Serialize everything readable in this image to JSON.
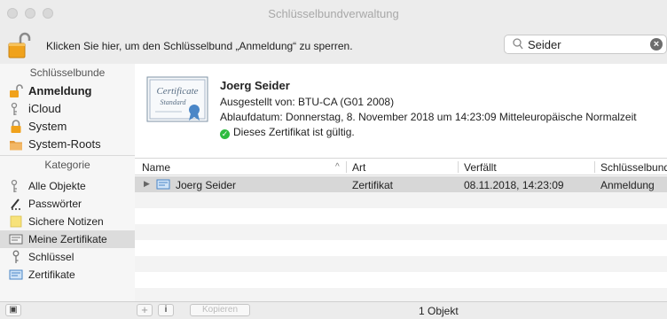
{
  "window": {
    "title": "Schlüsselbundverwaltung"
  },
  "toolbar": {
    "lock_text": "Klicken Sie hier, um den Schlüsselbund „Anmeldung“ zu sperren.",
    "search_value": "Seider"
  },
  "sidebar": {
    "keychains_header": "Schlüsselbunde",
    "keychains": [
      {
        "label": "Anmeldung",
        "icon": "open-lock-icon"
      },
      {
        "label": "iCloud",
        "icon": "cloud-keys-icon"
      },
      {
        "label": "System",
        "icon": "lock-icon"
      },
      {
        "label": "System-Roots",
        "icon": "folder-icon"
      }
    ],
    "category_header": "Kategorie",
    "categories": [
      {
        "label": "Alle Objekte",
        "icon": "keys-icon"
      },
      {
        "label": "Passwörter",
        "icon": "password-icon"
      },
      {
        "label": "Sichere Notizen",
        "icon": "note-icon"
      },
      {
        "label": "Meine Zertifikate",
        "icon": "my-cert-icon"
      },
      {
        "label": "Schlüssel",
        "icon": "key-icon"
      },
      {
        "label": "Zertifikate",
        "icon": "cert-icon"
      }
    ]
  },
  "detail": {
    "cert_image_text_1": "Certificate",
    "cert_image_text_2": "Standard",
    "name": "Joerg Seider",
    "issuer": "Ausgestellt von: BTU-CA (G01 2008)",
    "expiry": "Ablaufdatum: Donnerstag, 8. November 2018 um 14:23:09 Mitteleuropäische Normalzeit",
    "status": "Dieses Zertifikat ist gültig."
  },
  "table": {
    "columns": [
      "Name",
      "Art",
      "Verfällt",
      "Schlüsselbund"
    ],
    "rows": [
      {
        "name": "Joerg Seider",
        "kind": "Zertifikat",
        "expires": "08.11.2018, 14:23:09",
        "keychain": "Anmeldung"
      }
    ]
  },
  "bottom": {
    "add_label": "+",
    "info_label": "i",
    "copy_label": "Kopieren",
    "count": "1 Objekt"
  },
  "colors": {
    "selection": "#d7d7d7",
    "valid_green": "#2dbb3f",
    "chrome": "#ececec"
  }
}
